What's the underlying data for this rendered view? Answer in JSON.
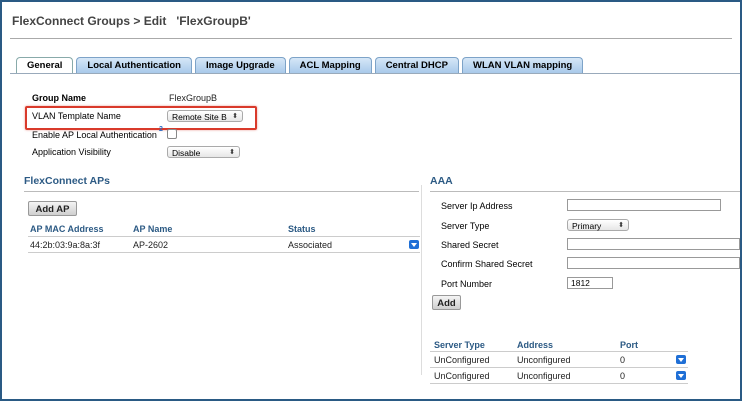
{
  "title": {
    "breadcrumb": "FlexConnect Groups > Edit",
    "group": "'FlexGroupB'"
  },
  "tabs": [
    {
      "label": "General",
      "active": true
    },
    {
      "label": "Local Authentication"
    },
    {
      "label": "Image Upgrade"
    },
    {
      "label": "ACL Mapping"
    },
    {
      "label": "Central DHCP"
    },
    {
      "label": "WLAN VLAN mapping"
    }
  ],
  "general": {
    "group_name_label": "Group Name",
    "group_name_value": "FlexGroupB",
    "vlan_template_label": "VLAN Template Name",
    "vlan_template_value": "Remote Site B",
    "local_auth_label": "Enable AP Local Authentication",
    "local_auth_help": "2",
    "app_visibility_label": "Application Visibility",
    "app_visibility_value": "Disable"
  },
  "aps": {
    "section_title": "FlexConnect APs",
    "add_button": "Add AP",
    "columns": [
      "AP MAC Address",
      "AP Name",
      "Status"
    ],
    "rows": [
      {
        "mac": "44:2b:03:9a:8a:3f",
        "name": "AP-2602",
        "status": "Associated"
      }
    ]
  },
  "aaa": {
    "section_title": "AAA",
    "server_ip_label": "Server Ip Address",
    "server_ip_value": "",
    "server_type_label": "Server Type",
    "server_type_value": "Primary",
    "shared_secret_label": "Shared Secret",
    "confirm_secret_label": "Confirm Shared Secret",
    "port_label": "Port Number",
    "port_value": "1812",
    "add_button": "Add",
    "columns": [
      "Server Type",
      "Address",
      "Port"
    ],
    "rows": [
      {
        "type": "UnConfigured",
        "address": "Unconfigured",
        "port": "0"
      },
      {
        "type": "UnConfigured",
        "address": "Unconfigured",
        "port": "0"
      }
    ]
  },
  "colors": {
    "accent": "#2c5a84",
    "highlight": "#d93a2b",
    "dropdown": "#1f6fd6"
  }
}
